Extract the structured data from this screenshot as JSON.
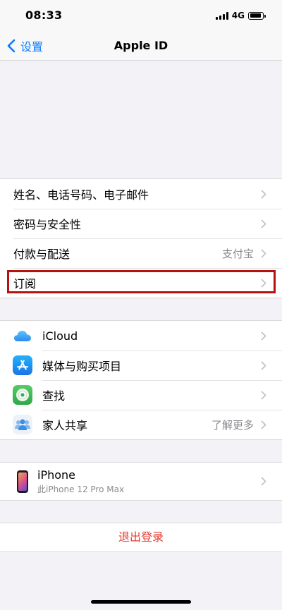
{
  "status_bar": {
    "time": "08:33",
    "network": "4G"
  },
  "nav": {
    "back_label": "设置",
    "title": "Apple ID"
  },
  "account_group": [
    {
      "label": "姓名、电话号码、电子邮件",
      "value": ""
    },
    {
      "label": "密码与安全性",
      "value": ""
    },
    {
      "label": "付款与配送",
      "value": "支付宝"
    },
    {
      "label": "订阅",
      "value": ""
    }
  ],
  "services_group": [
    {
      "label": "iCloud",
      "value": "",
      "icon": "icloud-icon"
    },
    {
      "label": "媒体与购买项目",
      "value": "",
      "icon": "app-store-icon"
    },
    {
      "label": "查找",
      "value": "",
      "icon": "find-my-icon"
    },
    {
      "label": "家人共享",
      "value": "了解更多",
      "icon": "family-sharing-icon"
    }
  ],
  "device": {
    "name": "iPhone",
    "subtitle": "此iPhone 12 Pro Max"
  },
  "sign_out": {
    "label": "退出登录"
  },
  "colors": {
    "accent": "#0a7aff",
    "destructive": "#e8392f",
    "highlight": "#b5120f"
  }
}
